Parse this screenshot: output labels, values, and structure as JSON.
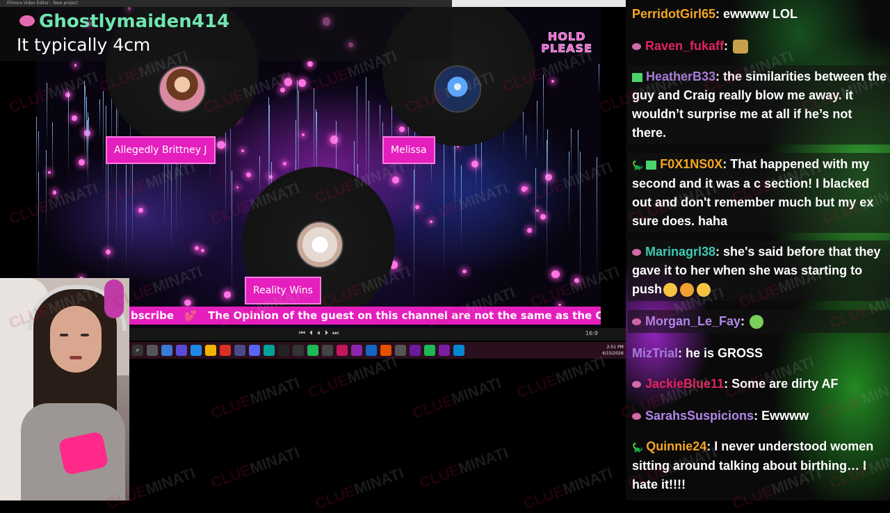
{
  "window": {
    "title": "Filmora Video Editor - New project"
  },
  "caption": {
    "username": "Ghostlymaiden414",
    "message": "It typically 4cm"
  },
  "stage": {
    "hold_line1": "HOLD",
    "hold_line2": "PLEASE",
    "guests": [
      {
        "name": "Allegedly Brittney J"
      },
      {
        "name": "Melissa"
      },
      {
        "name": "Reality Wins"
      }
    ],
    "ticker_text_1": "bscribe",
    "ticker_separator": "💕",
    "ticker_text_2": "The Opinion of the guest on this channel are not the same as the Chan"
  },
  "player": {
    "ratio": "16:9",
    "controls": [
      "⏮",
      "⏴",
      "⏸",
      "⏵",
      "⏭"
    ]
  },
  "taskbar": {
    "clock_time": "2:51 PM",
    "clock_date": "4/15/2026"
  },
  "watermark": {
    "part1": "CLUE",
    "part2": "MINATI"
  },
  "chat": {
    "messages": [
      {
        "user": "PerridotGirl65",
        "color": "#f5a623",
        "text": "ewwww LOL",
        "badge": "none",
        "boxed": false
      },
      {
        "user": "Raven_fukaff",
        "color": "#e0245e",
        "text": "",
        "badge": "heart",
        "emote": "food",
        "boxed": false
      },
      {
        "user": "HeatherB33",
        "color": "#a77bd8",
        "text": "the similarities between the guy and Craig really blow me away. it wouldn’t surprise me at all if he’s not there.",
        "badge": "sub",
        "boxed": true
      },
      {
        "user": "F0X1NS0X",
        "color": "#f5a623",
        "text": "That happened with my second and it was a c section! I blacked out and don't remember much but my ex sure does. haha",
        "badge": "dino-sub",
        "boxed": true
      },
      {
        "user": "Marinagrl38",
        "color": "#3ec9b4",
        "text": "she's said before that they gave it to her when she was starting to push",
        "badge": "heart",
        "emotes": [
          "laugh",
          "rofl",
          "laugh"
        ],
        "boxed": true
      },
      {
        "user": "Morgan_Le_Fay",
        "color": "#b286e8",
        "text": "",
        "badge": "heart",
        "emote": "sick",
        "boxed": true
      },
      {
        "user": "MizTrial",
        "color": "#a77bd8",
        "text": "he is GROSS",
        "badge": "none",
        "boxed": false
      },
      {
        "user": "JackieBlue11",
        "color": "#e0245e",
        "text": "Some are dirty AF",
        "badge": "heart",
        "boxed": false
      },
      {
        "user": "SarahsSuspicions",
        "color": "#b286e8",
        "text": "Ewwww",
        "badge": "heart",
        "boxed": false
      },
      {
        "user": "Quinnie24",
        "color": "#f5a623",
        "text": "I never understood women sitting around talking about birthing… I hate it!!!!",
        "badge": "dino",
        "boxed": false
      }
    ]
  }
}
